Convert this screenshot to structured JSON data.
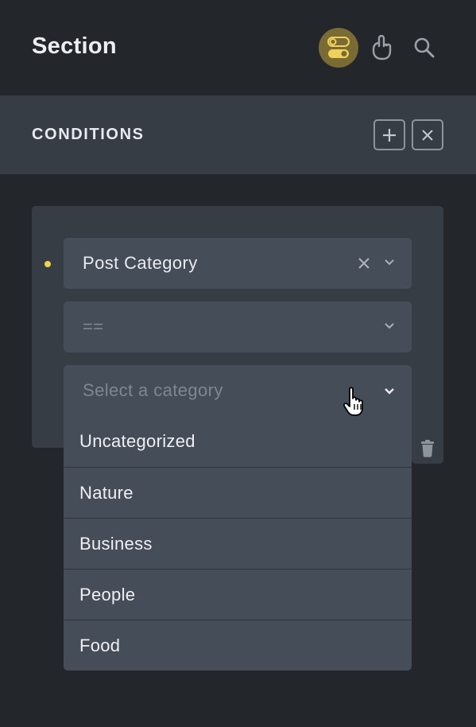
{
  "header": {
    "title": "Section",
    "icons": [
      "toggles-icon",
      "pointer-hand-icon",
      "search-icon"
    ]
  },
  "conditions": {
    "title": "CONDITIONS",
    "add_icon": "plus-icon",
    "close_icon": "close-icon"
  },
  "condition": {
    "status_dot_color": "#f0d34a",
    "field_select": {
      "value": "Post Category"
    },
    "operator_select": {
      "value": "=="
    },
    "value_select": {
      "placeholder": "Select a category",
      "options": [
        "Uncategorized",
        "Nature",
        "Business",
        "People",
        "Food"
      ]
    }
  },
  "colors": {
    "accent": "#7a6a33",
    "background": "#23272c",
    "panel": "#363d45",
    "field": "#454e58"
  }
}
